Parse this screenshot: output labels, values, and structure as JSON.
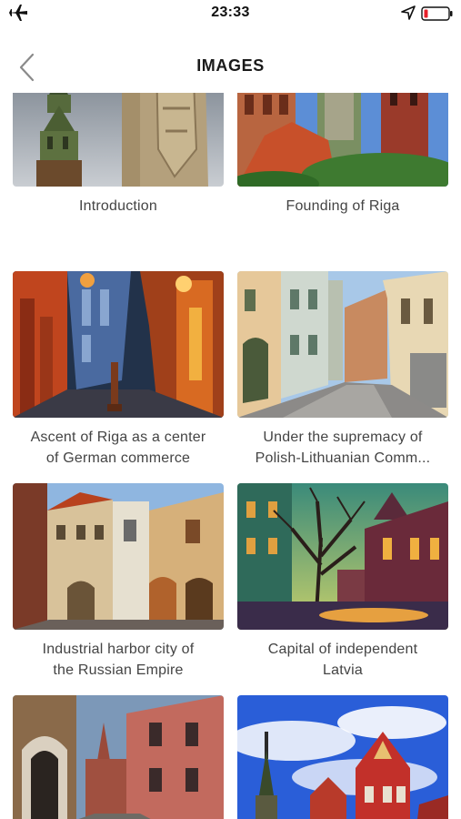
{
  "status_bar": {
    "time": "23:33",
    "icons": [
      "airplane-icon",
      "location-arrow-icon",
      "battery-low-icon"
    ],
    "battery_color": "#e8202a"
  },
  "header": {
    "title": "IMAGES",
    "back_icon": "chevron-left-icon"
  },
  "cards": [
    {
      "lines": [
        "Introduction"
      ]
    },
    {
      "lines": [
        "Founding of Riga"
      ]
    },
    {
      "lines": [
        "Ascent of Riga as a center",
        "of German commerce"
      ]
    },
    {
      "lines": [
        "Under the supremacy of",
        "Polish-Lithuanian Comm..."
      ]
    },
    {
      "lines": [
        "Industrial harbor city of",
        "the Russian Empire"
      ]
    },
    {
      "lines": [
        "Capital of independent",
        "Latvia"
      ]
    },
    {
      "lines": []
    },
    {
      "lines": []
    }
  ]
}
